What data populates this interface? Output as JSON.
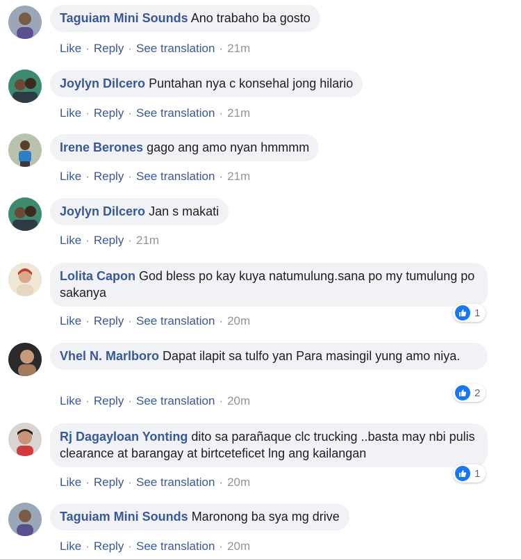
{
  "actions": {
    "like": "Like",
    "reply": "Reply",
    "see_translation": "See translation"
  },
  "comments": [
    {
      "author": "Taguiam Mini Sounds",
      "text": "Ano trabaho ba gosto",
      "time": "21m",
      "reactions": null
    },
    {
      "author": "Joylyn Dilcero",
      "text": "Puntahan nya c konsehal jong hilario",
      "time": "21m",
      "reactions": null
    },
    {
      "author": "Irene Berones",
      "text": "gago ang amo nyan hmmmm",
      "time": "21m",
      "reactions": null
    },
    {
      "author": "Joylyn Dilcero",
      "text": "Jan s makati",
      "time": "21m",
      "reactions": null
    },
    {
      "author": "Lolita Capon",
      "text": "God bless po kay kuya natumulung.sana po my tumulung po sakanya",
      "time": "20m",
      "reactions": "1"
    },
    {
      "author": "Vhel N. Marlboro",
      "text": "Dapat ilapit sa tulfo yan Para masingil yung amo niya.",
      "time": "20m",
      "reactions": "2"
    },
    {
      "author": "Rj Dagayloan Yonting",
      "text": "dito sa parañaque clc trucking ..basta may nbi pulis clearance at barangay at birtceteficet lng ang kailangan",
      "time": "20m",
      "reactions": "1"
    },
    {
      "author": "Taguiam Mini Sounds",
      "text": "Maronong ba sya mg drive",
      "time": "20m",
      "reactions": null
    }
  ],
  "colors": {
    "author": "#385898",
    "bubble": "#f0f2f5",
    "meta": "#90949c",
    "like_blue": "#1877f2"
  },
  "icons": {
    "reaction": "like-icon"
  }
}
